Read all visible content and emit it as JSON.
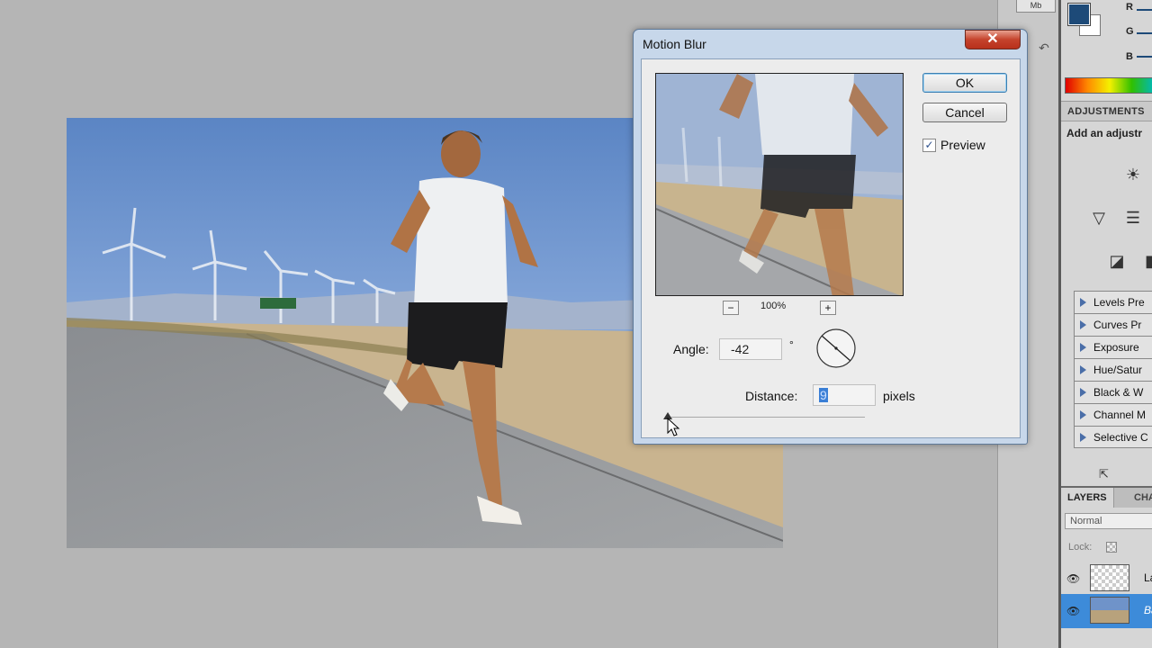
{
  "canvas": {
    "image_alt": "runner on road with wind turbines"
  },
  "toolbar": {
    "top_button": "Mb",
    "arrow_icon": "restore-arrow-icon"
  },
  "color_panel": {
    "fg_color": "#1d4a78",
    "bg_color": "#ffffff",
    "channels": [
      "R",
      "G",
      "B"
    ]
  },
  "adjustments": {
    "title": "ADJUSTMENTS",
    "subtitle": "Add an adjustr",
    "presets": [
      "Levels Pre",
      "Curves Pr",
      "Exposure",
      "Hue/Satur",
      "Black & W",
      "Channel M",
      "Selective C"
    ]
  },
  "layers": {
    "tabs": [
      "LAYERS",
      "CHA"
    ],
    "blend_mode": "Normal",
    "lock_label": "Lock:",
    "rows": [
      {
        "name": "La",
        "selected": false
      },
      {
        "name": "Ba",
        "selected": true
      }
    ]
  },
  "dialog": {
    "title": "Motion Blur",
    "close": "✕",
    "ok": "OK",
    "cancel": "Cancel",
    "preview_label": "Preview",
    "preview_checked": true,
    "zoom_out": "−",
    "zoom_in": "+",
    "zoom_level": "100%",
    "angle_label": "Angle:",
    "angle_value": "-42",
    "degree_symbol": "°",
    "distance_label": "Distance:",
    "distance_value": "9",
    "distance_unit": "pixels"
  }
}
